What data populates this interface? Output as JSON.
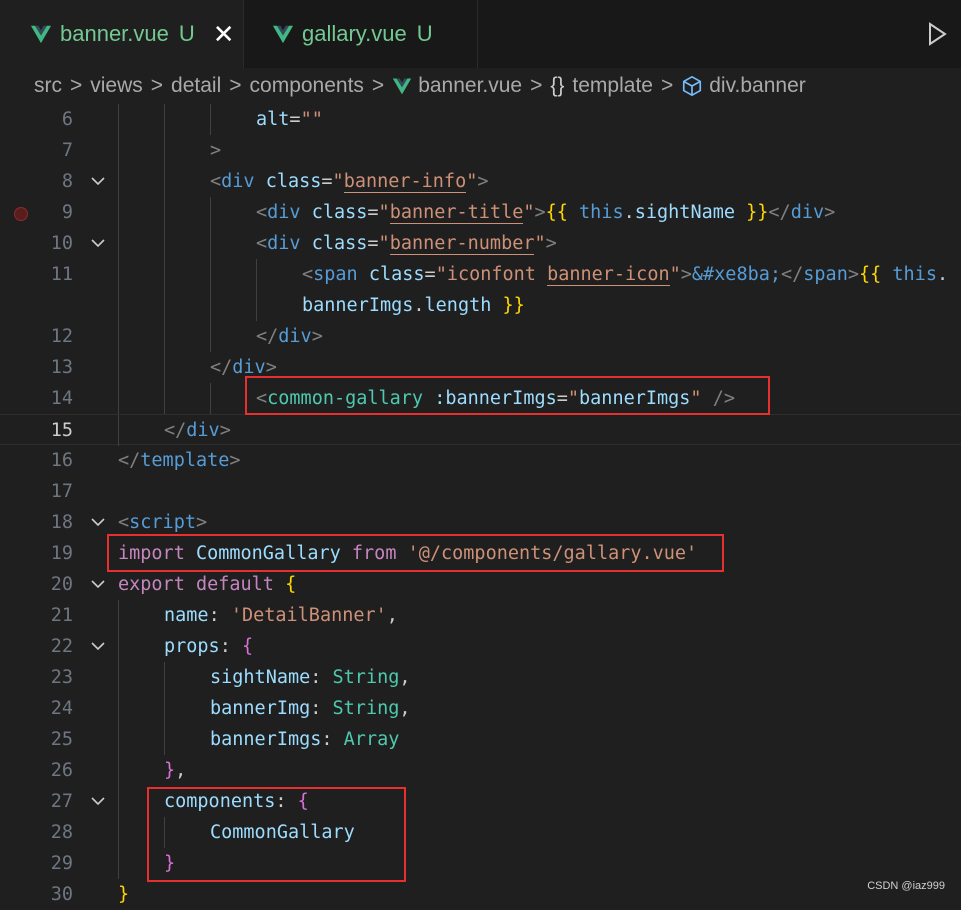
{
  "tabs": [
    {
      "label": "banner.vue",
      "status": "U",
      "active": true
    },
    {
      "label": "gallary.vue",
      "status": "U",
      "active": false
    }
  ],
  "tab_close_glyph": "✕",
  "breadcrumb": {
    "items": [
      "src",
      "views",
      "detail",
      "components",
      "banner.vue",
      "template",
      "div.banner"
    ],
    "separator": ">",
    "brace_glyph": "{}"
  },
  "lines": [
    {
      "n": "6",
      "code": [
        [
          "t-attr",
          "alt"
        ],
        [
          "t-txt",
          "="
        ],
        [
          "t-str",
          "\"\""
        ]
      ]
    },
    {
      "n": "7",
      "code": [
        [
          "t-br",
          ">"
        ]
      ]
    },
    {
      "n": "8",
      "code": [
        [
          "t-br",
          "<"
        ],
        [
          "t-tag",
          "div"
        ],
        [
          "t-txt",
          " "
        ],
        [
          "t-attr",
          "class"
        ],
        [
          "t-txt",
          "="
        ],
        [
          "t-str",
          "\""
        ],
        [
          "t-str ul",
          "banner-info"
        ],
        [
          "t-str",
          "\""
        ],
        [
          "t-br",
          ">"
        ]
      ]
    },
    {
      "n": "9",
      "code": [
        [
          "t-br",
          "<"
        ],
        [
          "t-tag",
          "div"
        ],
        [
          "t-txt",
          " "
        ],
        [
          "t-attr",
          "class"
        ],
        [
          "t-txt",
          "="
        ],
        [
          "t-str",
          "\""
        ],
        [
          "t-str ul",
          "banner-title"
        ],
        [
          "t-str",
          "\""
        ],
        [
          "t-br",
          ">"
        ],
        [
          "t-brace1",
          "{{"
        ],
        [
          "t-txt",
          " "
        ],
        [
          "t-this",
          "this"
        ],
        [
          "t-txt",
          "."
        ],
        [
          "t-var",
          "sightName"
        ],
        [
          "t-txt",
          " "
        ],
        [
          "t-brace1",
          "}}"
        ],
        [
          "t-br",
          "</"
        ],
        [
          "t-tag",
          "div"
        ],
        [
          "t-br",
          ">"
        ]
      ]
    },
    {
      "n": "10",
      "code": [
        [
          "t-br",
          "<"
        ],
        [
          "t-tag",
          "div"
        ],
        [
          "t-txt",
          " "
        ],
        [
          "t-attr",
          "class"
        ],
        [
          "t-txt",
          "="
        ],
        [
          "t-str",
          "\""
        ],
        [
          "t-str ul",
          "banner-number"
        ],
        [
          "t-str",
          "\""
        ],
        [
          "t-br",
          ">"
        ]
      ]
    },
    {
      "n": "11",
      "code": [
        [
          "t-br",
          "<"
        ],
        [
          "t-tag",
          "span"
        ],
        [
          "t-txt",
          " "
        ],
        [
          "t-attr",
          "class"
        ],
        [
          "t-txt",
          "="
        ],
        [
          "t-str",
          "\"iconfont "
        ],
        [
          "t-str ul",
          "banner-icon"
        ],
        [
          "t-str",
          "\""
        ],
        [
          "t-br",
          ">"
        ],
        [
          "t-ent",
          "&#xe8ba;"
        ],
        [
          "t-br",
          "</"
        ],
        [
          "t-tag",
          "span"
        ],
        [
          "t-br",
          ">"
        ],
        [
          "t-brace1",
          "{{"
        ],
        [
          "t-txt",
          " "
        ],
        [
          "t-this",
          "this"
        ],
        [
          "t-txt",
          "."
        ]
      ]
    },
    {
      "n": "",
      "code": [
        [
          "t-var",
          "bannerImgs"
        ],
        [
          "t-txt",
          "."
        ],
        [
          "t-var",
          "length"
        ],
        [
          "t-txt",
          " "
        ],
        [
          "t-brace1",
          "}}"
        ]
      ]
    },
    {
      "n": "12",
      "code": [
        [
          "t-br",
          "</"
        ],
        [
          "t-tag",
          "div"
        ],
        [
          "t-br",
          ">"
        ]
      ]
    },
    {
      "n": "13",
      "code": [
        [
          "t-br",
          "</"
        ],
        [
          "t-tag",
          "div"
        ],
        [
          "t-br",
          ">"
        ]
      ]
    },
    {
      "n": "14",
      "code": [
        [
          "t-br",
          "<"
        ],
        [
          "t-type",
          "common-gallary"
        ],
        [
          "t-txt",
          " "
        ],
        [
          "t-attr",
          ":bannerImgs"
        ],
        [
          "t-txt",
          "="
        ],
        [
          "t-str",
          "\""
        ],
        [
          "t-var",
          "bannerImgs"
        ],
        [
          "t-str",
          "\""
        ],
        [
          "t-txt",
          " "
        ],
        [
          "t-br",
          "/>"
        ]
      ]
    },
    {
      "n": "15",
      "code": [
        [
          "t-br",
          "</"
        ],
        [
          "t-tag",
          "div"
        ],
        [
          "t-br",
          ">"
        ]
      ]
    },
    {
      "n": "16",
      "code": [
        [
          "t-br",
          "</"
        ],
        [
          "t-tag",
          "template"
        ],
        [
          "t-br",
          ">"
        ]
      ]
    },
    {
      "n": "17",
      "code": []
    },
    {
      "n": "18",
      "code": [
        [
          "t-br",
          "<"
        ],
        [
          "t-tag",
          "script"
        ],
        [
          "t-br",
          ">"
        ]
      ]
    },
    {
      "n": "19",
      "code": [
        [
          "t-kw",
          "import"
        ],
        [
          "t-txt",
          " "
        ],
        [
          "t-var",
          "CommonGallary"
        ],
        [
          "t-txt",
          " "
        ],
        [
          "t-kw",
          "from"
        ],
        [
          "t-txt",
          " "
        ],
        [
          "t-str",
          "'@/components/gallary.vue'"
        ]
      ]
    },
    {
      "n": "20",
      "code": [
        [
          "t-kw",
          "export"
        ],
        [
          "t-txt",
          " "
        ],
        [
          "t-kw",
          "default"
        ],
        [
          "t-txt",
          " "
        ],
        [
          "t-brace1",
          "{"
        ]
      ]
    },
    {
      "n": "21",
      "code": [
        [
          "t-var",
          "name"
        ],
        [
          "t-txt",
          ": "
        ],
        [
          "t-str",
          "'DetailBanner'"
        ],
        [
          "t-txt",
          ","
        ]
      ]
    },
    {
      "n": "22",
      "code": [
        [
          "t-var",
          "props"
        ],
        [
          "t-txt",
          ": "
        ],
        [
          "t-brace2",
          "{"
        ]
      ]
    },
    {
      "n": "23",
      "code": [
        [
          "t-var",
          "sightName"
        ],
        [
          "t-txt",
          ": "
        ],
        [
          "t-type",
          "String"
        ],
        [
          "t-txt",
          ","
        ]
      ]
    },
    {
      "n": "24",
      "code": [
        [
          "t-var",
          "bannerImg"
        ],
        [
          "t-txt",
          ": "
        ],
        [
          "t-type",
          "String"
        ],
        [
          "t-txt",
          ","
        ]
      ]
    },
    {
      "n": "25",
      "code": [
        [
          "t-var",
          "bannerImgs"
        ],
        [
          "t-txt",
          ": "
        ],
        [
          "t-type",
          "Array"
        ]
      ]
    },
    {
      "n": "26",
      "code": [
        [
          "t-brace2",
          "}"
        ],
        [
          "t-txt",
          ","
        ]
      ]
    },
    {
      "n": "27",
      "code": [
        [
          "t-var",
          "components"
        ],
        [
          "t-txt",
          ": "
        ],
        [
          "t-brace2",
          "{"
        ]
      ]
    },
    {
      "n": "28",
      "code": [
        [
          "t-var",
          "CommonGallary"
        ]
      ]
    },
    {
      "n": "29",
      "code": [
        [
          "t-brace2",
          "}"
        ]
      ]
    },
    {
      "n": "30",
      "code": [
        [
          "t-brace1",
          "}"
        ]
      ]
    }
  ],
  "watermark": "CSDN @iaz999"
}
